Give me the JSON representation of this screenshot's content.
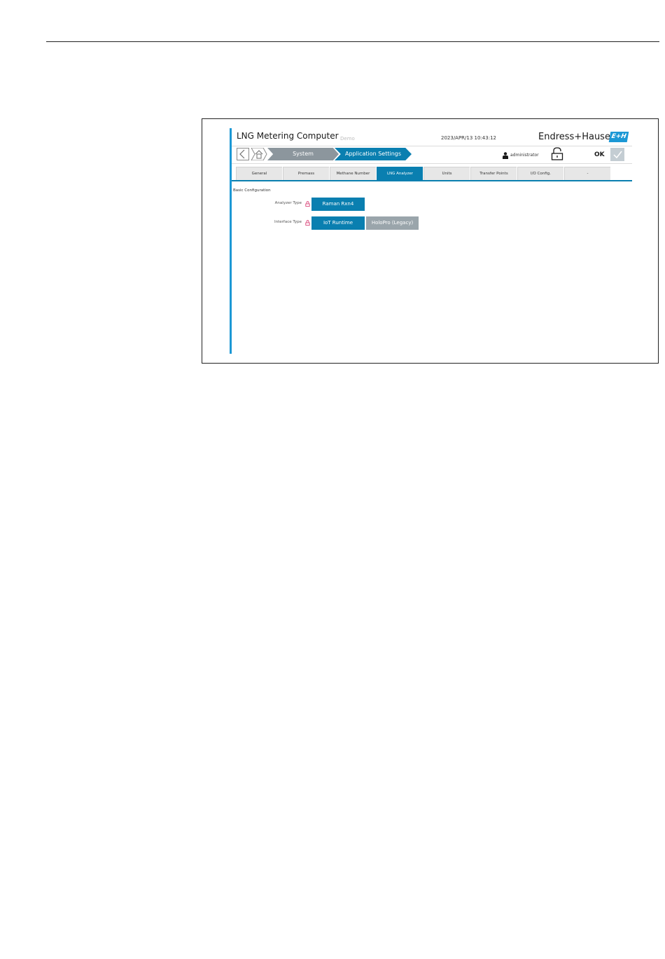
{
  "header": {
    "app_title": "LNG Metering Computer",
    "demo_tag": "Demo",
    "datetime": "2023/APR/13 10:43:12",
    "brand": "Endress+Hauser",
    "brand_logo": "E+H"
  },
  "nav": {
    "back_icon": "chevron-left-icon",
    "home_icon": "home-icon",
    "crumbs": [
      "System",
      "Application Settings"
    ],
    "user_icon": "user-icon",
    "username": "administrator",
    "lock_icon": "unlocked-padlock-icon",
    "ok_label": "OK",
    "confirm_icon": "check-icon"
  },
  "tabs": [
    {
      "label": "General"
    },
    {
      "label": "Premass"
    },
    {
      "label": "Methane Number"
    },
    {
      "label": "LNG Analyzer",
      "active": true
    },
    {
      "label": "Units"
    },
    {
      "label": "Transfer Points"
    },
    {
      "label": "I/O Config."
    },
    {
      "label": "-"
    }
  ],
  "section": {
    "title": "Basic Configuration",
    "fields": [
      {
        "label": "Analyzer Type",
        "options": [
          "Raman Rxn4"
        ],
        "selected": "Raman Rxn4"
      },
      {
        "label": "Interface Type",
        "options": [
          "IoT Runtime",
          "HoloPro (Legacy)"
        ],
        "selected": "IoT Runtime"
      }
    ]
  },
  "colors": {
    "accent": "#1c98d5",
    "primary": "#0a7fb0",
    "inactive": "#9aa5ab",
    "lock_red": "#d6336c"
  }
}
